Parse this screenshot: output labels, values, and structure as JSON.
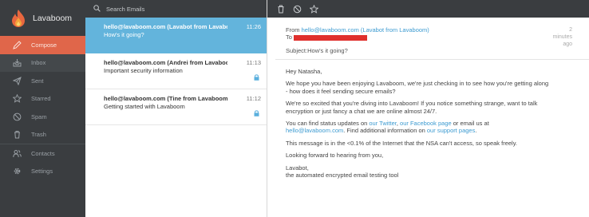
{
  "app": {
    "name": "Lavaboom"
  },
  "sidebar": {
    "items": [
      {
        "label": "Compose",
        "icon": "pencil-icon"
      },
      {
        "label": "Inbox",
        "icon": "inbox-icon"
      },
      {
        "label": "Sent",
        "icon": "paper-plane-icon"
      },
      {
        "label": "Starred",
        "icon": "star-icon"
      },
      {
        "label": "Spam",
        "icon": "ban-icon"
      },
      {
        "label": "Trash",
        "icon": "trash-icon"
      },
      {
        "label": "Contacts",
        "icon": "contacts-icon"
      },
      {
        "label": "Settings",
        "icon": "gear-icon"
      }
    ]
  },
  "search": {
    "placeholder": "Search Emails"
  },
  "mails": [
    {
      "from": "hello@lavaboom.com (Lavabot from Lavaboo...",
      "subject": "How's it going?",
      "time": "11:26"
    },
    {
      "from": "hello@lavaboom.com (Andrei from Lavaboom)",
      "subject": "Important security information",
      "time": "11:13"
    },
    {
      "from": "hello@lavaboom.com (Tine from Lavaboom)",
      "subject": "Getting started with Lavaboom",
      "time": "11:12"
    }
  ],
  "reader": {
    "from_label": "From",
    "from_value": "hello@lavaboom.com (Lavabot from Lavaboom)",
    "to_label": "To",
    "subject_label": "Subject",
    "subject_value": "How's it going?",
    "ago_1": "2",
    "ago_2": "minutes",
    "ago_3": "ago",
    "greeting": "Hey Natasha,",
    "p1": "We hope you have been enjoying Lavaboom, we're just checking in to see how you're getting along - how does it feel sending secure emails?",
    "p2": "We're so excited that you're diving into Lavaboom! If you notice something strange, want to talk encryption or just fancy a chat we are online almost 24/7.",
    "p3_a": "You can find status updates on ",
    "p3_twitter": "our Twitter",
    "p3_b": ", ",
    "p3_facebook": "our Facebook page",
    "p3_c": " or email us at ",
    "p3_email": "hello@lavaboom.com",
    "p3_d": ". Find additional information on ",
    "p3_support": "our support pages",
    "p3_e": ".",
    "p4": "This message is in the <0.1% of the Internet that the NSA can't access, so speak freely.",
    "p5": "Looking forward to hearing from you,",
    "sig1": "Lavabot,",
    "sig2": "the automated encrypted email testing tool"
  },
  "colors": {
    "sidebar_bg": "#3a3d40",
    "accent": "#e0664a",
    "selected_mail": "#63b4dc",
    "link": "#3d9bd1",
    "redaction": "#e0302d"
  }
}
